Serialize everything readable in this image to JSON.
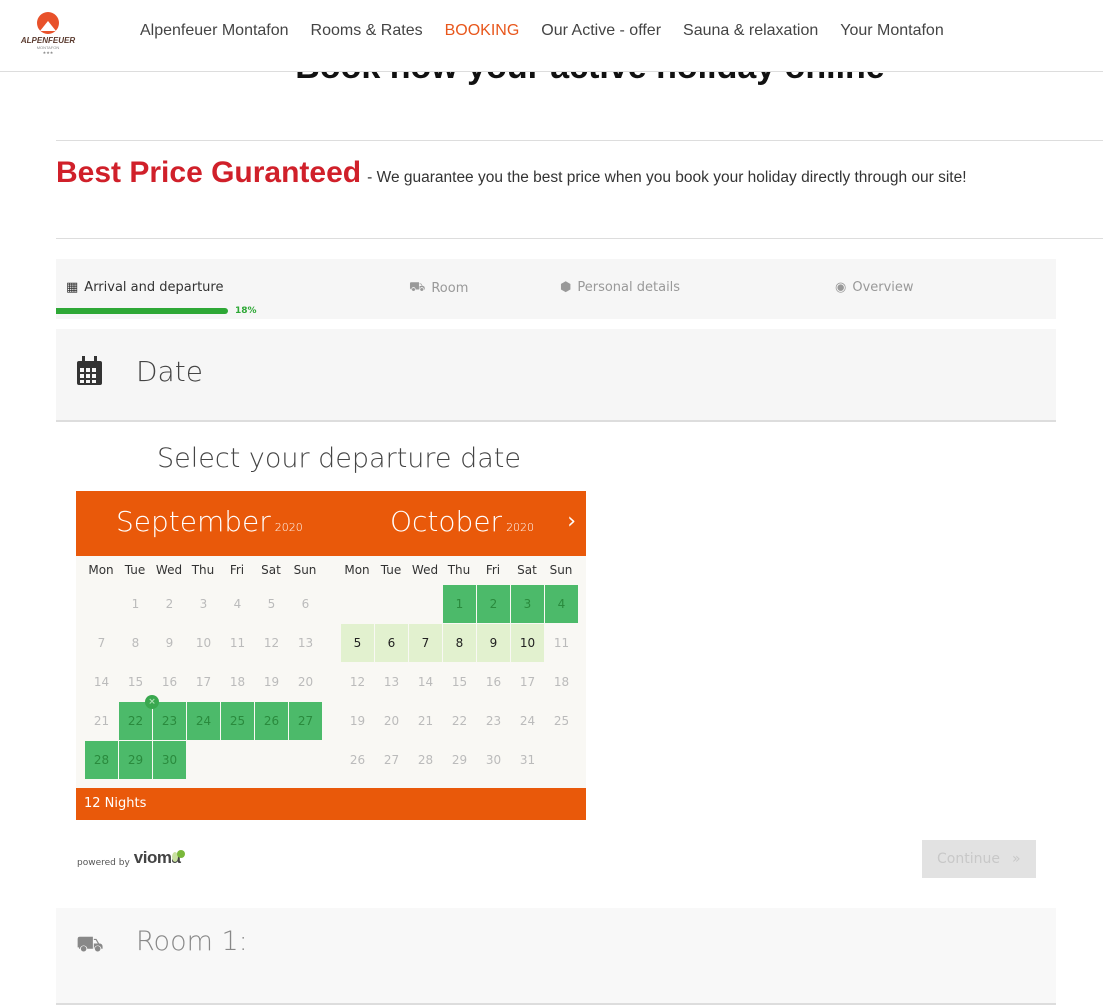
{
  "header": {
    "logo": {
      "name": "ALPENFEUER",
      "sub": "MONTAFON",
      "stars": "★★★"
    },
    "nav": [
      {
        "label": "Alpenfeuer Montafon"
      },
      {
        "label": "Rooms & Rates"
      },
      {
        "label": "BOOKING",
        "active": true
      },
      {
        "label": "Our Active - offer"
      },
      {
        "label": "Sauna & relaxation"
      },
      {
        "label": "Your Montafon"
      }
    ]
  },
  "page": {
    "title": "Book now your active holiday online",
    "best_price": "Best Price Guranteed",
    "best_price_text": "- We guarantee you the best price when you book your holiday directly through our site!"
  },
  "steps": {
    "items": [
      {
        "label": "Arrival and departure",
        "icon": "calendar-icon"
      },
      {
        "label": "Room",
        "icon": "bed-icon"
      },
      {
        "label": "Personal details",
        "icon": "tag-icon"
      },
      {
        "label": "Overview",
        "icon": "eye-icon"
      }
    ],
    "progress": "18%",
    "progress_value": 18
  },
  "date_section": {
    "title": "Date",
    "prompt": "Select your departure date"
  },
  "calendar": {
    "weekdays": [
      "Mon",
      "Tue",
      "Wed",
      "Thu",
      "Fri",
      "Sat",
      "Sun"
    ],
    "months": [
      {
        "name": "September",
        "year": "2020",
        "offset": 1,
        "days": 30,
        "selected": [
          22,
          23,
          24,
          25,
          26,
          27,
          28,
          29,
          30
        ],
        "available": []
      },
      {
        "name": "October",
        "year": "2020",
        "offset": 3,
        "days": 31,
        "selected": [
          1,
          2,
          3,
          4
        ],
        "available": [
          5,
          6,
          7,
          8,
          9,
          10
        ]
      }
    ],
    "arrival_marker": {
      "month": 0,
      "day": 22,
      "icon": "remove-icon"
    },
    "nights": "12 Nights",
    "colors": {
      "header": "#e9590a",
      "selected": "#4cba6a",
      "available": "#e2f1cf"
    }
  },
  "footer": {
    "powered_by": "powered by",
    "brand": "vioma",
    "continue": "Continue",
    "continue_icon": "»"
  },
  "room_section": {
    "title": "Room 1:"
  }
}
